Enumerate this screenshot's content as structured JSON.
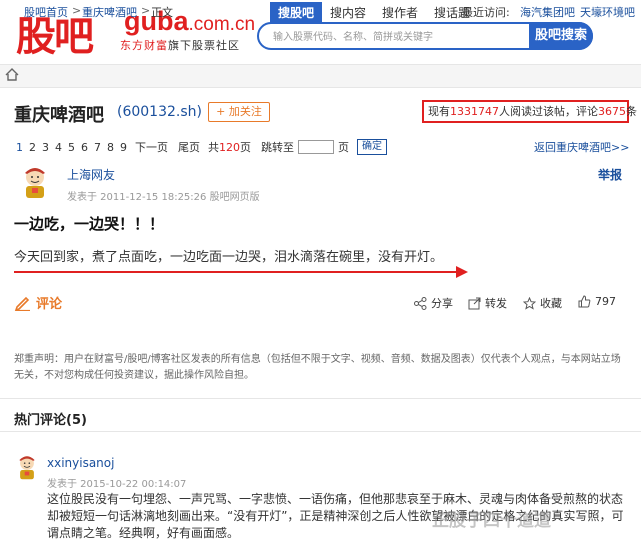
{
  "header": {
    "logo_cn": "股吧",
    "logo_guba": "guba",
    "logo_com": ".com.cn",
    "logo_sub_brand": "东方财富",
    "logo_sub_rest": "旗下股票社区",
    "tabs": [
      "搜股吧",
      "搜内容",
      "搜作者",
      "搜话题"
    ],
    "search_placeholder": "输入股票代码、名称、简拼或关键字",
    "search_button": "股吧搜索"
  },
  "breadcrumb": {
    "home": "股吧首页",
    "sep1": ">",
    "forum": "重庆啤酒吧",
    "sep2": ">",
    "current": "正文",
    "recent_label": "最近访问:",
    "recent_items": [
      "海汽集团吧",
      "天壕环境吧"
    ]
  },
  "stock": {
    "name": "重庆啤酒吧",
    "code": "(600132.sh)",
    "follow": "+ 加关注",
    "stats_prefix": "现有",
    "readers": "1331747",
    "stats_mid": "人阅读过该帖，评论",
    "comments": "3675",
    "stats_suffix": "条"
  },
  "pagination": {
    "pages": [
      "1",
      "2",
      "3",
      "4",
      "5",
      "6",
      "7",
      "8",
      "9"
    ],
    "next": "下一页",
    "last": "尾页",
    "total_prefix": "共",
    "total": "120",
    "total_suffix": "页",
    "jump_label": "跳转至",
    "page_unit": "页",
    "confirm": "确定",
    "back": "返回重庆啤酒吧>>"
  },
  "post": {
    "author": "上海网友",
    "time": "发表于 2011-12-15 18:25:26 股吧网页版",
    "report": "举报",
    "title": "一边吃，一边哭！！！",
    "body": "今天回到家，煮了点面吃，一边吃面一边哭，泪水滴落在碗里，没有开灯。",
    "comment_label": "评论",
    "share": "分享",
    "forward": "转发",
    "favorite": "收藏",
    "likes": "797"
  },
  "disclaimer": "郑重声明：用户在财富号/股吧/博客社区发表的所有信息（包括但不限于文字、视频、音频、数据及图表）仅代表个人观点，与本网站立场无关，不对您构成任何投资建议，据此操作风险自担。",
  "hot_comments": {
    "title": "热门评论(5)",
    "items": [
      {
        "user": "xxinyisanoj",
        "time": "发表于 2015-10-22 00:14:07",
        "body": "这位股民没有一句埋怨、一声咒骂、一字悲愤、一语伤痛，但他那悲哀至于麻木、灵魂与肉体备受煎熬的状态却被短短一句话淋漓地刻画出来。“没有开灯”，正是精神深创之后人性欲望被漂白的定格之纪的真实写照，可谓点睛之笔。经典啊，好有画面感。"
      }
    ]
  },
  "watermark": "正股子四十道道",
  "colors": {
    "brand_red": "#e02020",
    "brand_blue": "#2a63c6",
    "link_blue": "#1a4f9c",
    "orange": "#e87a2a"
  }
}
